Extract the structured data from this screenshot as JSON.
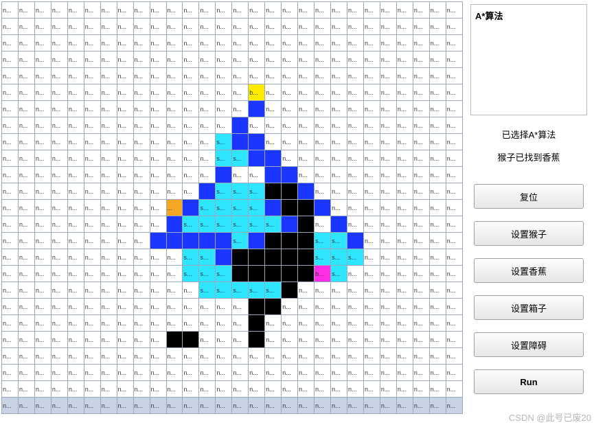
{
  "grid": {
    "rows": 25,
    "cols": 28,
    "default_label": "n...",
    "colors": {
      "white": "#ffffff",
      "blue": "#1a36ff",
      "cyan": "#2ee6ff",
      "black": "#000000",
      "yellow": "#ffeb00",
      "orange": "#f5a623",
      "magenta": "#ff2ee6",
      "selrow": "#c8d4e6"
    },
    "cells": [
      {
        "r": 5,
        "c": 15,
        "bg": "yellow",
        "t": "b..."
      },
      {
        "r": 6,
        "c": 15,
        "bg": "blue",
        "t": ""
      },
      {
        "r": 7,
        "c": 14,
        "bg": "blue",
        "t": ""
      },
      {
        "r": 7,
        "c": 15,
        "bg": "white",
        "t": "n..."
      },
      {
        "r": 8,
        "c": 13,
        "bg": "cyan",
        "t": "s..."
      },
      {
        "r": 8,
        "c": 14,
        "bg": "blue",
        "t": ""
      },
      {
        "r": 8,
        "c": 15,
        "bg": "blue",
        "t": ""
      },
      {
        "r": 9,
        "c": 13,
        "bg": "cyan",
        "t": "s..."
      },
      {
        "r": 9,
        "c": 14,
        "bg": "cyan",
        "t": "s..."
      },
      {
        "r": 9,
        "c": 15,
        "bg": "blue",
        "t": ""
      },
      {
        "r": 9,
        "c": 16,
        "bg": "blue",
        "t": ""
      },
      {
        "r": 10,
        "c": 13,
        "bg": "blue",
        "t": ""
      },
      {
        "r": 10,
        "c": 14,
        "bg": "white",
        "t": "n..."
      },
      {
        "r": 10,
        "c": 16,
        "bg": "blue",
        "t": ""
      },
      {
        "r": 10,
        "c": 17,
        "bg": "blue",
        "t": ""
      },
      {
        "r": 11,
        "c": 12,
        "bg": "blue",
        "t": ""
      },
      {
        "r": 11,
        "c": 13,
        "bg": "cyan",
        "t": "s..."
      },
      {
        "r": 11,
        "c": 14,
        "bg": "cyan",
        "t": "s..."
      },
      {
        "r": 11,
        "c": 15,
        "bg": "cyan",
        "t": "s..."
      },
      {
        "r": 11,
        "c": 16,
        "bg": "black",
        "t": ""
      },
      {
        "r": 11,
        "c": 17,
        "bg": "black",
        "t": ""
      },
      {
        "r": 11,
        "c": 18,
        "bg": "blue",
        "t": ""
      },
      {
        "r": 12,
        "c": 10,
        "bg": "orange",
        "t": "..."
      },
      {
        "r": 12,
        "c": 11,
        "bg": "blue",
        "t": ""
      },
      {
        "r": 12,
        "c": 12,
        "bg": "cyan",
        "t": "s..."
      },
      {
        "r": 12,
        "c": 13,
        "bg": "cyan",
        "t": "s..."
      },
      {
        "r": 12,
        "c": 14,
        "bg": "cyan",
        "t": "s..."
      },
      {
        "r": 12,
        "c": 15,
        "bg": "cyan",
        "t": "s..."
      },
      {
        "r": 12,
        "c": 16,
        "bg": "blue",
        "t": ""
      },
      {
        "r": 12,
        "c": 17,
        "bg": "black",
        "t": ""
      },
      {
        "r": 12,
        "c": 18,
        "bg": "black",
        "t": ""
      },
      {
        "r": 12,
        "c": 19,
        "bg": "blue",
        "t": ""
      },
      {
        "r": 13,
        "c": 10,
        "bg": "blue",
        "t": ""
      },
      {
        "r": 13,
        "c": 11,
        "bg": "cyan",
        "t": "s..."
      },
      {
        "r": 13,
        "c": 12,
        "bg": "cyan",
        "t": "s..."
      },
      {
        "r": 13,
        "c": 13,
        "bg": "cyan",
        "t": "s..."
      },
      {
        "r": 13,
        "c": 14,
        "bg": "cyan",
        "t": "s..."
      },
      {
        "r": 13,
        "c": 15,
        "bg": "cyan",
        "t": "s..."
      },
      {
        "r": 13,
        "c": 16,
        "bg": "cyan",
        "t": "s..."
      },
      {
        "r": 13,
        "c": 17,
        "bg": "blue",
        "t": ""
      },
      {
        "r": 13,
        "c": 18,
        "bg": "black",
        "t": ""
      },
      {
        "r": 13,
        "c": 20,
        "bg": "blue",
        "t": ""
      },
      {
        "r": 14,
        "c": 9,
        "bg": "blue",
        "t": ""
      },
      {
        "r": 14,
        "c": 10,
        "bg": "blue",
        "t": ""
      },
      {
        "r": 14,
        "c": 11,
        "bg": "blue",
        "t": ""
      },
      {
        "r": 14,
        "c": 12,
        "bg": "blue",
        "t": ""
      },
      {
        "r": 14,
        "c": 13,
        "bg": "blue",
        "t": ""
      },
      {
        "r": 14,
        "c": 14,
        "bg": "cyan",
        "t": "s..."
      },
      {
        "r": 14,
        "c": 15,
        "bg": "blue",
        "t": ""
      },
      {
        "r": 14,
        "c": 16,
        "bg": "black",
        "t": ""
      },
      {
        "r": 14,
        "c": 17,
        "bg": "black",
        "t": ""
      },
      {
        "r": 14,
        "c": 18,
        "bg": "black",
        "t": ""
      },
      {
        "r": 14,
        "c": 19,
        "bg": "cyan",
        "t": "s..."
      },
      {
        "r": 14,
        "c": 20,
        "bg": "cyan",
        "t": "s..."
      },
      {
        "r": 14,
        "c": 21,
        "bg": "blue",
        "t": ""
      },
      {
        "r": 15,
        "c": 11,
        "bg": "cyan",
        "t": "s..."
      },
      {
        "r": 15,
        "c": 12,
        "bg": "cyan",
        "t": "s..."
      },
      {
        "r": 15,
        "c": 13,
        "bg": "blue",
        "t": ""
      },
      {
        "r": 15,
        "c": 14,
        "bg": "black",
        "t": ""
      },
      {
        "r": 15,
        "c": 15,
        "bg": "black",
        "t": ""
      },
      {
        "r": 15,
        "c": 16,
        "bg": "black",
        "t": ""
      },
      {
        "r": 15,
        "c": 17,
        "bg": "black",
        "t": ""
      },
      {
        "r": 15,
        "c": 18,
        "bg": "black",
        "t": ""
      },
      {
        "r": 15,
        "c": 19,
        "bg": "cyan",
        "t": "s..."
      },
      {
        "r": 15,
        "c": 20,
        "bg": "cyan",
        "t": "s..."
      },
      {
        "r": 15,
        "c": 21,
        "bg": "cyan",
        "t": "s..."
      },
      {
        "r": 16,
        "c": 11,
        "bg": "cyan",
        "t": "s..."
      },
      {
        "r": 16,
        "c": 12,
        "bg": "cyan",
        "t": "s..."
      },
      {
        "r": 16,
        "c": 13,
        "bg": "cyan",
        "t": "s..."
      },
      {
        "r": 16,
        "c": 14,
        "bg": "black",
        "t": ""
      },
      {
        "r": 16,
        "c": 15,
        "bg": "black",
        "t": ""
      },
      {
        "r": 16,
        "c": 16,
        "bg": "black",
        "t": ""
      },
      {
        "r": 16,
        "c": 17,
        "bg": "black",
        "t": ""
      },
      {
        "r": 16,
        "c": 18,
        "bg": "black",
        "t": ""
      },
      {
        "r": 16,
        "c": 19,
        "bg": "magenta",
        "t": "b..."
      },
      {
        "r": 16,
        "c": 20,
        "bg": "cyan",
        "t": "s..."
      },
      {
        "r": 17,
        "c": 12,
        "bg": "cyan",
        "t": "s..."
      },
      {
        "r": 17,
        "c": 13,
        "bg": "cyan",
        "t": "s..."
      },
      {
        "r": 17,
        "c": 14,
        "bg": "cyan",
        "t": "s..."
      },
      {
        "r": 17,
        "c": 15,
        "bg": "cyan",
        "t": "s..."
      },
      {
        "r": 17,
        "c": 16,
        "bg": "cyan",
        "t": "s..."
      },
      {
        "r": 17,
        "c": 17,
        "bg": "black",
        "t": ""
      },
      {
        "r": 18,
        "c": 15,
        "bg": "black",
        "t": ""
      },
      {
        "r": 18,
        "c": 16,
        "bg": "black",
        "t": ""
      },
      {
        "r": 19,
        "c": 15,
        "bg": "black",
        "t": ""
      },
      {
        "r": 20,
        "c": 10,
        "bg": "black",
        "t": ""
      },
      {
        "r": 20,
        "c": 11,
        "bg": "black",
        "t": ""
      },
      {
        "r": 20,
        "c": 15,
        "bg": "black",
        "t": ""
      }
    ],
    "selected_row": 24
  },
  "info_box": {
    "title": "A*算法"
  },
  "status": {
    "line1": "已选择A*算法",
    "line2": "猴子已找到香蕉"
  },
  "buttons": {
    "reset": "复位",
    "set_monkey": "设置猴子",
    "set_banana": "设置香蕉",
    "set_box": "设置箱子",
    "set_obstacle": "设置障碍",
    "run": "Run"
  },
  "watermark": "CSDN @此号已废20"
}
